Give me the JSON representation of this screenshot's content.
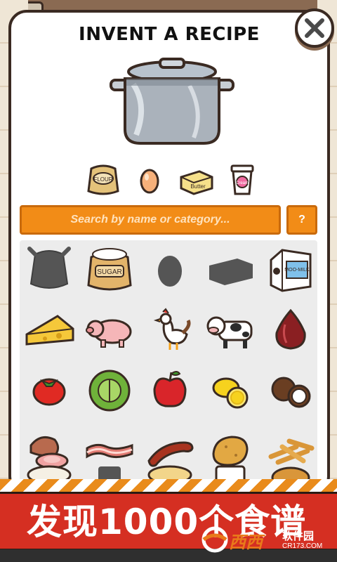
{
  "title": "INVENT A RECIPE",
  "search": {
    "placeholder": "Search by name or category..."
  },
  "help_label": "?",
  "recipe_slots": [
    {
      "name": "flour-sack-icon",
      "label": "FLOUR"
    },
    {
      "name": "egg-icon"
    },
    {
      "name": "butter-icon",
      "label": "Butter"
    },
    {
      "name": "cream-cup-icon",
      "label": "Cream"
    }
  ],
  "ingredients": [
    {
      "name": "flour-sack-silhouette-icon",
      "locked": true
    },
    {
      "name": "sugar-sack-icon",
      "label": "SUGAR"
    },
    {
      "name": "egg-silhouette-icon",
      "locked": true
    },
    {
      "name": "butter-silhouette-icon",
      "locked": true
    },
    {
      "name": "milk-carton-icon",
      "label": "MOO-MILK"
    },
    {
      "name": "cheese-icon"
    },
    {
      "name": "pig-icon"
    },
    {
      "name": "chicken-icon"
    },
    {
      "name": "cow-icon"
    },
    {
      "name": "red-onion-icon"
    },
    {
      "name": "tomato-icon"
    },
    {
      "name": "cabbage-icon"
    },
    {
      "name": "apple-icon"
    },
    {
      "name": "lemon-icon"
    },
    {
      "name": "coconut-icon"
    },
    {
      "name": "ham-icon"
    },
    {
      "name": "bacon-icon"
    },
    {
      "name": "sausage-icon"
    },
    {
      "name": "potato-icon"
    },
    {
      "name": "fries-icon"
    }
  ],
  "banner": {
    "text": "发现1000个食谱"
  },
  "watermark": {
    "brand": "西西",
    "sub": "软件园",
    "url": "CR173.COM"
  },
  "colors": {
    "accent": "#f28c17",
    "banner": "#d52f22",
    "outline": "#3a2a22"
  }
}
